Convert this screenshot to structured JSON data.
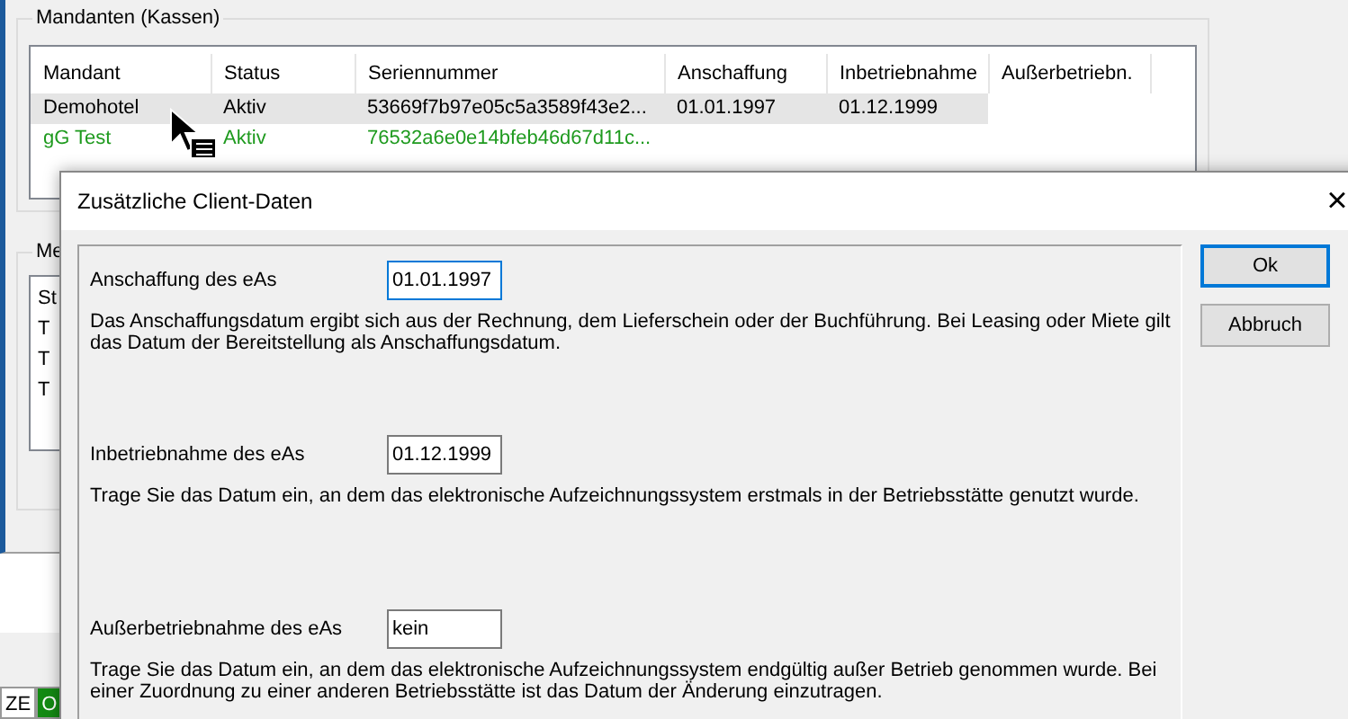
{
  "background_window": {
    "clients_group": {
      "title": "Mandanten (Kassen)",
      "columns": [
        "Mandant",
        "Status",
        "Seriennummer",
        "Anschaffung",
        "Inbetriebnahme",
        "Außerbetriebn."
      ],
      "rows": [
        {
          "cells": [
            "Demohotel",
            "Aktiv",
            "53669f7b97e05c5a3589f43e2...",
            "01.01.1997",
            "01.12.1999"
          ],
          "selected": true,
          "color": "#000000"
        },
        {
          "cells": [
            "gG Test",
            "Aktiv",
            "76532a6e0e14bfeb46d67d11c..."
          ],
          "selected": false,
          "color": "#1e9a1e"
        }
      ]
    },
    "messages_group": {
      "title": "Me",
      "column_1": "St",
      "rows": [
        "T",
        "T",
        "T"
      ]
    },
    "status_cells": [
      {
        "text": "ZE",
        "color": "#ffffff"
      },
      {
        "text": "O",
        "color": "#138a13"
      }
    ]
  },
  "dialog": {
    "title": "Zusätzliche Client-Daten",
    "close": "×",
    "fields": [
      {
        "label": "Anschaffung des eAs",
        "value": "01.01.1997",
        "focused": true,
        "description": "Das Anschaffungsdatum ergibt sich aus der Rechnung, dem Lieferschein oder der Buchführung. Bei Leasing oder Miete gilt das Datum der Bereitstellung als Anschaffungsdatum."
      },
      {
        "label": "Inbetriebnahme des eAs",
        "value": "01.12.1999",
        "focused": false,
        "description": "Trage Sie das Datum ein, an dem das elektronische Aufzeichnungssystem erstmals in der Betriebsstätte genutzt wurde."
      },
      {
        "label": "Außerbetriebnahme des eAs",
        "value": "kein",
        "focused": false,
        "description": "Trage Sie das Datum ein, an dem das elektronische Aufzeichnungssystem endgültig außer Betrieb genommen wurde. Bei einer Zuordnung zu einer anderen Betriebsstätte ist das Datum der Änderung einzutragen."
      }
    ],
    "buttons": [
      {
        "label": "Ok",
        "default": true
      },
      {
        "label": "Abbruch",
        "default": false
      }
    ]
  }
}
